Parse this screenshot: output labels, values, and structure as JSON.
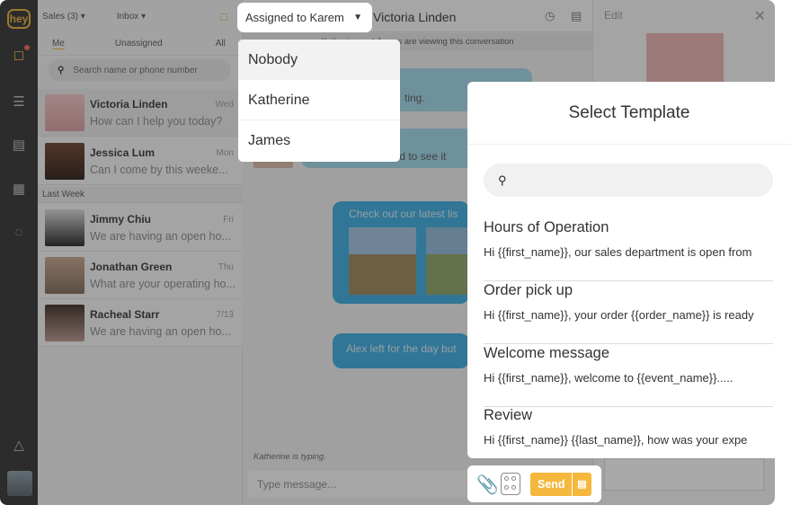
{
  "rail": {
    "logo": "hey"
  },
  "list": {
    "account": "Sales (3)",
    "box": "Inbox",
    "tabs": [
      "Me",
      "Unassigned",
      "All"
    ],
    "search_placeholder": "Search name or phone number",
    "section_last_week": "Last Week",
    "conversations": [
      {
        "name": "Victoria Linden",
        "time": "Wed",
        "preview": "How can I help you today?"
      },
      {
        "name": "Jessica Lum",
        "time": "Mon",
        "preview": "Can I come by this weeke..."
      },
      {
        "name": "Jimmy Chiu",
        "time": "Fri",
        "preview": "We are having an open ho..."
      },
      {
        "name": "Jonathan Green",
        "time": "Thu",
        "preview": "What are your operating ho..."
      },
      {
        "name": "Racheal Starr",
        "time": "7/13",
        "preview": "We are having an open ho..."
      }
    ]
  },
  "chat": {
    "title": "Victoria Linden",
    "viewing": "Katherine and James are viewing this conversation",
    "bubble1": "ting.",
    "bubble2": "ward to see it",
    "card_caption": "Check out our latest lis",
    "bubble3": "Alex left for the day but",
    "typing": "Katherine is typing.",
    "composer_placeholder": "Type message..."
  },
  "right": {
    "edit": "Edit"
  },
  "assign": {
    "label": "Assigned to Karem",
    "options": [
      "Nobody",
      "Katherine",
      "James"
    ]
  },
  "templates": {
    "title": "Select Template",
    "items": [
      {
        "title": "Hours of Operation",
        "body": "Hi {{first_name}}, our sales department is open from"
      },
      {
        "title": "Order pick up",
        "body": "Hi {{first_name}}, your order {{order_name}} is ready"
      },
      {
        "title": "Welcome message",
        "body": "Hi {{first_name}}, welcome to {{event_name}}....."
      },
      {
        "title": "Review",
        "body": "Hi {{first_name}} {{last_name}}, how was your expe"
      }
    ]
  },
  "toolbar": {
    "send": "Send"
  }
}
